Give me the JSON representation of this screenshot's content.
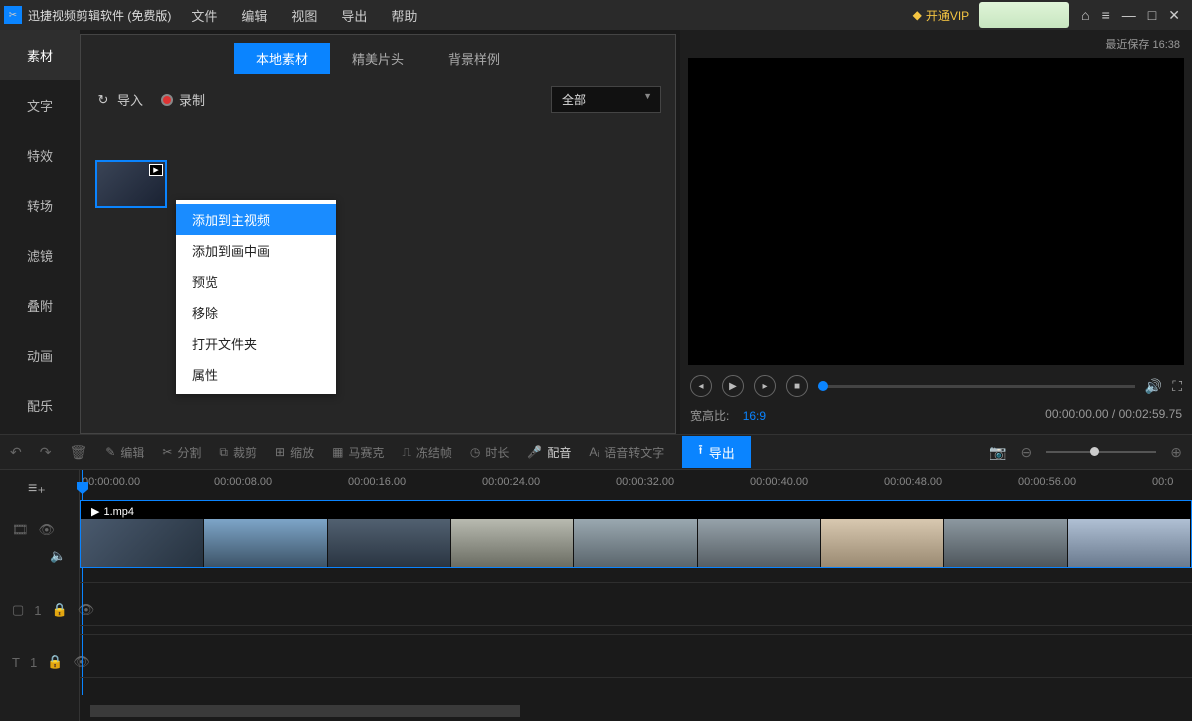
{
  "titlebar": {
    "app_title": "迅捷视频剪辑软件 (免费版)",
    "menu": [
      "文件",
      "编辑",
      "视图",
      "导出",
      "帮助"
    ],
    "vip_label": "开通VIP"
  },
  "save_info": {
    "label": "最近保存",
    "time": "16:38"
  },
  "side_nav": [
    "素材",
    "文字",
    "特效",
    "转场",
    "滤镜",
    "叠附",
    "动画",
    "配乐"
  ],
  "asset_tabs": [
    "本地素材",
    "精美片头",
    "背景样例"
  ],
  "asset_toolbar": {
    "import": "导入",
    "record": "录制",
    "filter": "全部"
  },
  "context_menu": [
    "添加到主视频",
    "添加到画中画",
    "预览",
    "移除",
    "打开文件夹",
    "属性"
  ],
  "preview": {
    "aspect_label": "宽高比:",
    "aspect_value": "16:9",
    "time_current": "00:00:00.00",
    "time_total": "00:02:59.75"
  },
  "tool_row": {
    "edit": "编辑",
    "split": "分割",
    "crop": "裁剪",
    "zoom": "缩放",
    "mosaic": "马赛克",
    "freeze": "冻结帧",
    "duration": "时长",
    "dub": "配音",
    "stt": "语音转文字",
    "export": "导出"
  },
  "timeline": {
    "marks": [
      "00:00:00.00",
      "00:00:08.00",
      "00:00:16.00",
      "00:00:24.00",
      "00:00:32.00",
      "00:00:40.00",
      "00:00:48.00",
      "00:00:56.00",
      "00:0"
    ],
    "clip_name": "1.mp4",
    "track2_label": "1",
    "track3_label": "1"
  }
}
